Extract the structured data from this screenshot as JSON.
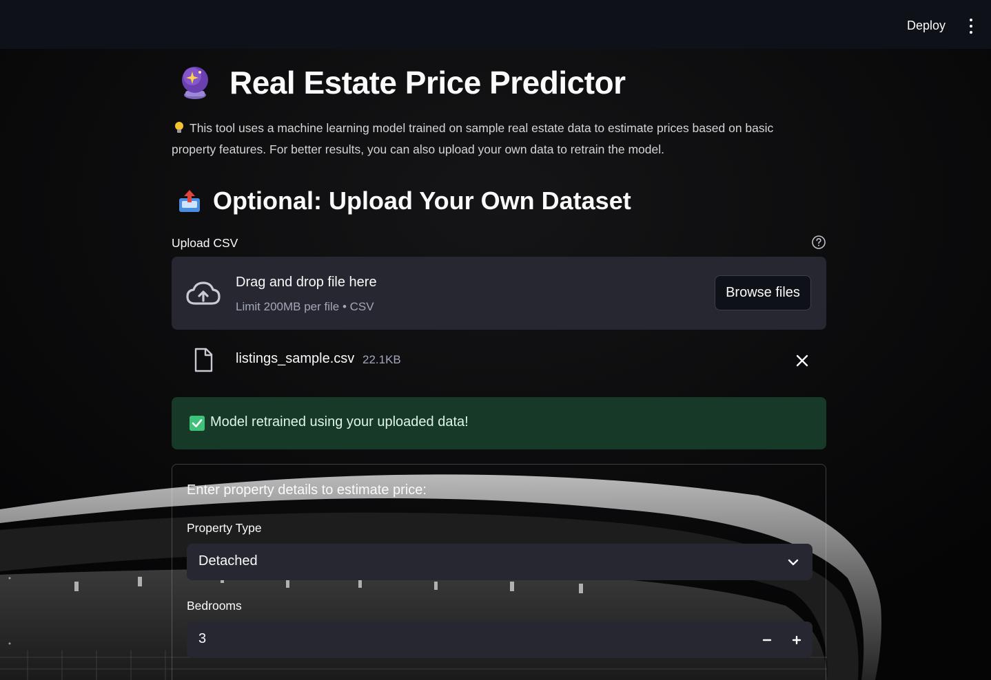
{
  "header": {
    "deploy_label": "Deploy",
    "menu_icon": "kebab-menu-icon"
  },
  "main": {
    "title_icon": "crystal-ball-icon",
    "title": "Real Estate Price Predictor",
    "intro_icon": "light-bulb-icon",
    "intro_text": "This tool uses a machine learning model trained on sample real estate data to estimate prices based on basic property features. For better results, you can also upload your own data to retrain the model.",
    "upload_section": {
      "icon": "inbox-tray-icon",
      "heading": "Optional: Upload Your Own Dataset",
      "label": "Upload CSV",
      "help_icon": "help-circle-icon",
      "dropzone_title": "Drag and drop file here",
      "dropzone_limit": "Limit 200MB per file • CSV",
      "browse_label": "Browse files",
      "file": {
        "name": "listings_sample.csv",
        "size": "22.1KB"
      }
    },
    "success_message": "Model retrained using your uploaded data!",
    "form": {
      "heading": "Enter property details to estimate price:",
      "property_type": {
        "label": "Property Type",
        "value": "Detached"
      },
      "bedrooms": {
        "label": "Bedrooms",
        "value": "3"
      }
    }
  },
  "colors": {
    "topbar": "#0e1117",
    "widget_bg": "#262730",
    "success_bg": "#173928",
    "text": "#fafafa"
  }
}
